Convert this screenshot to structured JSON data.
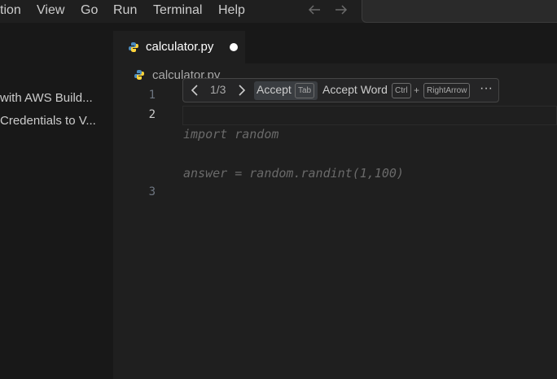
{
  "menubar": {
    "items": [
      "tion",
      "View",
      "Go",
      "Run",
      "Terminal",
      "Help"
    ],
    "back_icon": "arrow-left-icon",
    "forward_icon": "arrow-right-icon"
  },
  "sidebar": {
    "rows": [
      "with AWS Build...",
      "Credentials to V..."
    ]
  },
  "editor": {
    "tab": {
      "label": "calculator.py",
      "icon": "python-file-icon",
      "dirty": true
    },
    "breadcrumb": "calculator.py",
    "line_numbers": [
      "1",
      "2",
      "3"
    ],
    "ghost_text": [
      "import random",
      "answer = random.randint(1,100)"
    ]
  },
  "suggestion_toolbar": {
    "counter": "1/3",
    "accept_label": "Accept",
    "accept_key": "Tab",
    "accept_word_label": "Accept Word",
    "accept_word_key_1": "Ctrl",
    "plus": "+",
    "accept_word_key_2": "RightArrow",
    "more": "···"
  },
  "colors": {
    "background": "#1f1f1f",
    "sidebar": "#181818",
    "ghost_text": "#6a6a6a",
    "python_blue": "#4b8bbe",
    "python_yellow": "#ffd43b"
  }
}
